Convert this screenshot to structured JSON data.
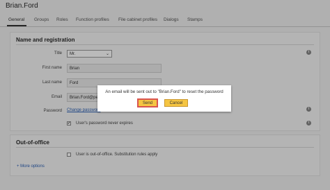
{
  "window": {
    "title": "Brian.Ford"
  },
  "tabs": [
    {
      "label": "General"
    },
    {
      "label": "Groups"
    },
    {
      "label": "Roles"
    },
    {
      "label": "Function profiles"
    },
    {
      "label": "File cabinet profiles"
    },
    {
      "label": "Dialogs"
    },
    {
      "label": "Stamps"
    }
  ],
  "section_name": {
    "title": "Name and registration",
    "title_label": "Title",
    "title_value": "Mr.",
    "first_name_label": "First name",
    "first_name_value": "Brian",
    "last_name_label": "Last name",
    "last_name_value": "Ford",
    "email_label": "Email",
    "email_value": "Brian.Ford@pet",
    "password_label": "Password",
    "password_link": "Change password",
    "never_expires_label": "User's password never expires",
    "never_expires_checked": true
  },
  "section_ooo": {
    "title": "Out-of-office",
    "ooo_label": "User is out-of-office. Substitution rules apply",
    "ooo_checked": false,
    "more_options": "+ More options"
  },
  "dialog": {
    "message": "An email will be sent out to \"Brian.Ford\" to reset the password",
    "send_label": "Send",
    "cancel_label": "Cancel"
  },
  "icons": {
    "info": "info-icon",
    "chevron": "chevron-down-icon"
  },
  "colors": {
    "accent_button": "#f5c542",
    "focus_outline": "#d9534f",
    "link": "#2a5fb5"
  }
}
